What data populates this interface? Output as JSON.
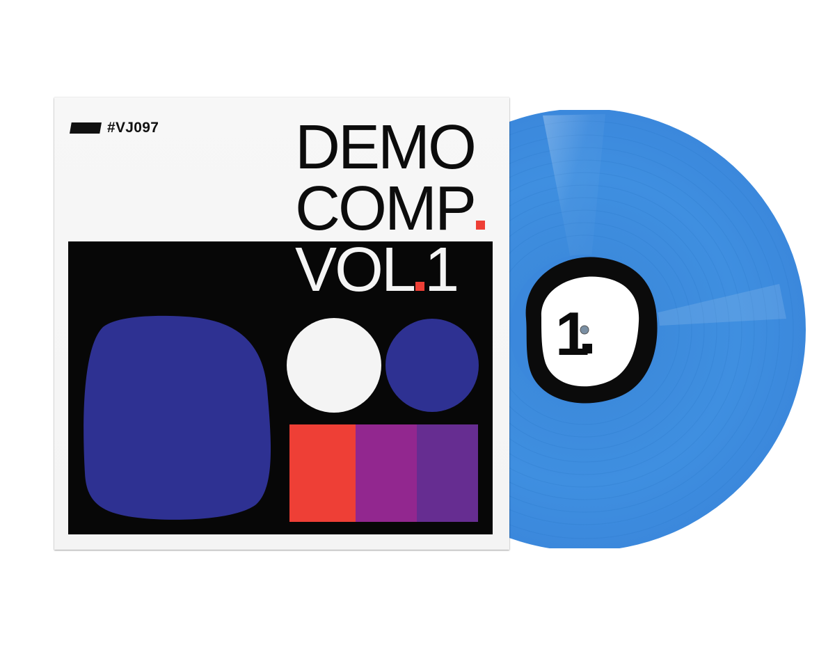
{
  "sleeve": {
    "catalog_number": "#VJ097",
    "title_line_1": "DEMO",
    "title_line_2": "COMP",
    "title_line_3": "VOL",
    "title_line_3_suffix": "1"
  },
  "record": {
    "label_text": "1"
  },
  "colors": {
    "vinyl_blue": "#3f8fe0",
    "deep_blue": "#2e3192",
    "red": "#ee3f36",
    "magenta": "#92278f",
    "purple": "#662d91",
    "black": "#070707",
    "white": "#f4f4f4"
  }
}
